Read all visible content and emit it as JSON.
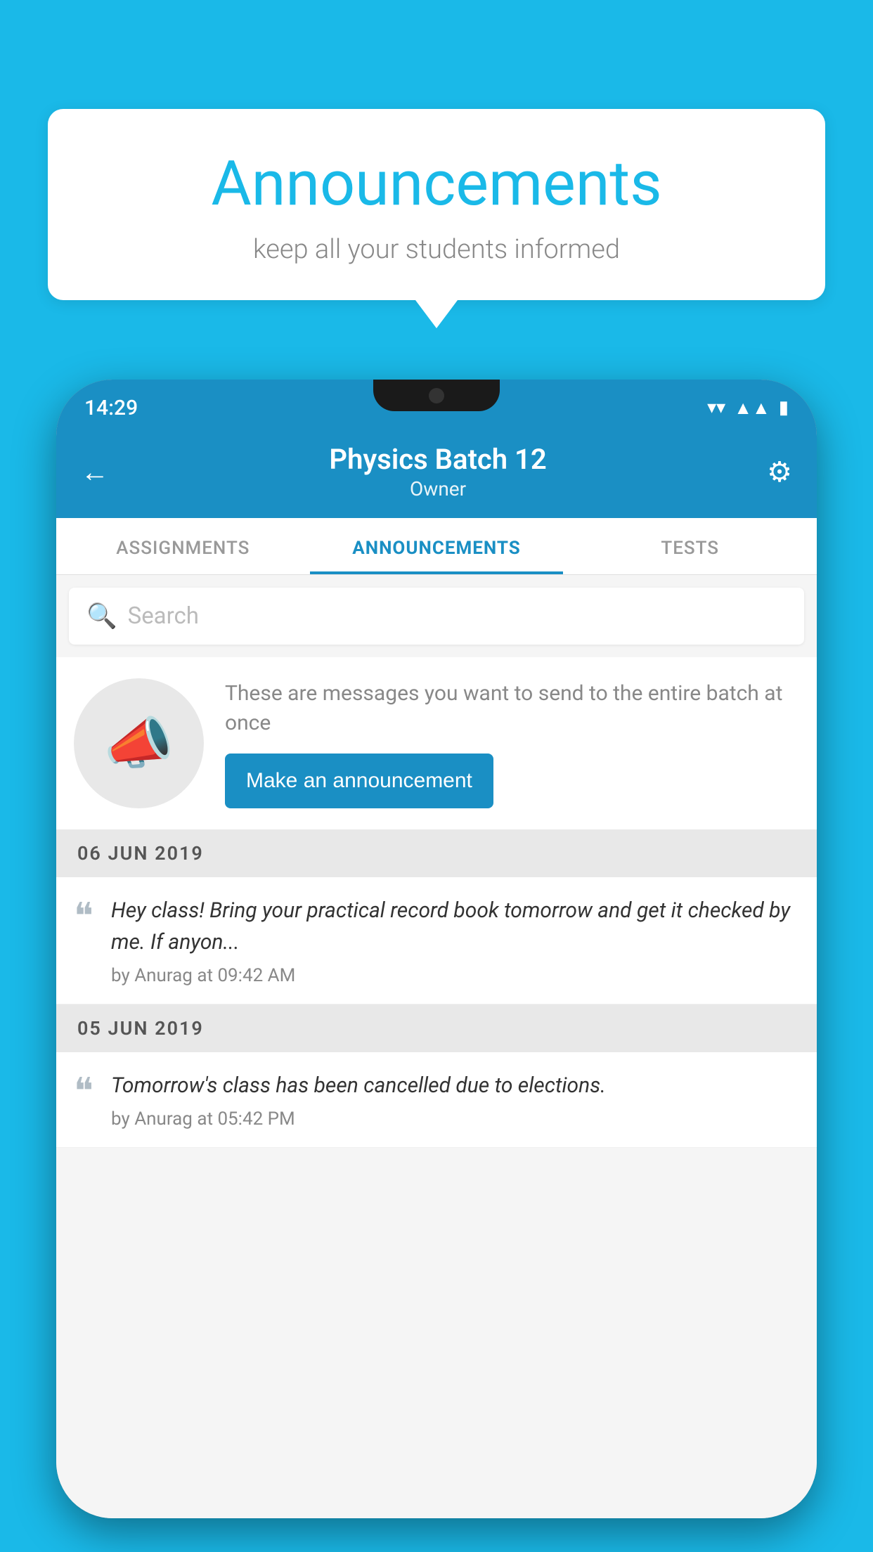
{
  "background_color": "#1ab9e8",
  "bubble": {
    "title": "Announcements",
    "subtitle": "keep all your students informed"
  },
  "status_bar": {
    "time": "14:29",
    "wifi": "▼",
    "signal": "▲",
    "battery": "▮"
  },
  "header": {
    "title": "Physics Batch 12",
    "subtitle": "Owner",
    "back_label": "←",
    "gear_label": "⚙"
  },
  "tabs": [
    {
      "label": "ASSIGNMENTS",
      "active": false
    },
    {
      "label": "ANNOUNCEMENTS",
      "active": true
    },
    {
      "label": "TESTS",
      "active": false
    }
  ],
  "search": {
    "placeholder": "Search"
  },
  "promo": {
    "description": "These are messages you want to send to the entire batch at once",
    "button_label": "Make an announcement"
  },
  "dates": [
    {
      "date": "06  JUN  2019",
      "announcements": [
        {
          "text": "Hey class! Bring your practical record book tomorrow and get it checked by me. If anyon...",
          "meta": "by Anurag at 09:42 AM"
        }
      ]
    },
    {
      "date": "05  JUN  2019",
      "announcements": [
        {
          "text": "Tomorrow's class has been cancelled due to elections.",
          "meta": "by Anurag at 05:42 PM"
        }
      ]
    }
  ]
}
